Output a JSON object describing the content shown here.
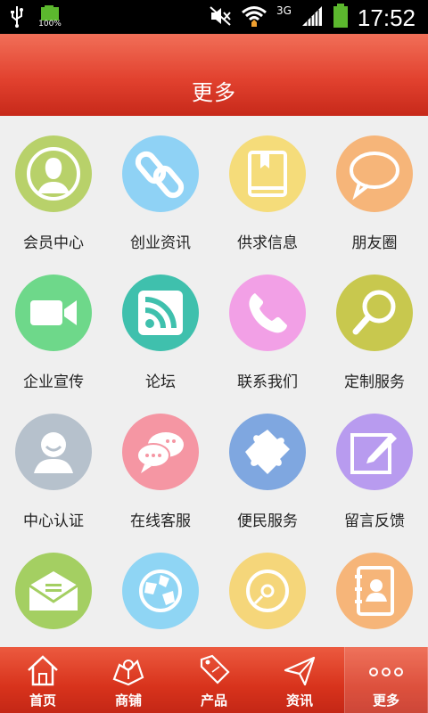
{
  "status_bar": {
    "time": "17:52",
    "battery_left_percent": "100%",
    "network": "3G"
  },
  "header": {
    "title": "更多"
  },
  "grid": [
    {
      "label": "会员中心",
      "icon": "person-icon",
      "color": "#b8d16a"
    },
    {
      "label": "创业资讯",
      "icon": "link-icon",
      "color": "#8fd2f5"
    },
    {
      "label": "供求信息",
      "icon": "book-icon",
      "color": "#f5dc7a"
    },
    {
      "label": "朋友圈",
      "icon": "speech-bubble-icon",
      "color": "#f6b579"
    },
    {
      "label": "企业宣传",
      "icon": "video-camera-icon",
      "color": "#6ed88a"
    },
    {
      "label": "论坛",
      "icon": "rss-icon",
      "color": "#3fc0ad"
    },
    {
      "label": "联系我们",
      "icon": "phone-icon",
      "color": "#f2a0e6"
    },
    {
      "label": "定制服务",
      "icon": "magnifier-icon",
      "color": "#c8c84e"
    },
    {
      "label": "中心认证",
      "icon": "user-face-icon",
      "color": "#b6c1cc"
    },
    {
      "label": "在线客服",
      "icon": "chat-bubbles-icon",
      "color": "#f596a3"
    },
    {
      "label": "便民服务",
      "icon": "puzzle-icon",
      "color": "#7fa7e0"
    },
    {
      "label": "留言反馈",
      "icon": "edit-icon",
      "color": "#b89bef"
    },
    {
      "label": "",
      "icon": "envelope-icon",
      "color": "#a4cf62"
    },
    {
      "label": "",
      "icon": "globe-icon",
      "color": "#8fd5f4"
    },
    {
      "label": "",
      "icon": "disc-icon",
      "color": "#f5d67a"
    },
    {
      "label": "",
      "icon": "contact-book-icon",
      "color": "#f6b579"
    }
  ],
  "tabbar": [
    {
      "label": "首页",
      "icon": "home-icon",
      "active": false
    },
    {
      "label": "商铺",
      "icon": "shop-icon",
      "active": false
    },
    {
      "label": "产品",
      "icon": "sale-tag-icon",
      "active": false
    },
    {
      "label": "资讯",
      "icon": "paper-plane-icon",
      "active": false
    },
    {
      "label": "更多",
      "icon": "more-dots-icon",
      "active": true
    }
  ]
}
